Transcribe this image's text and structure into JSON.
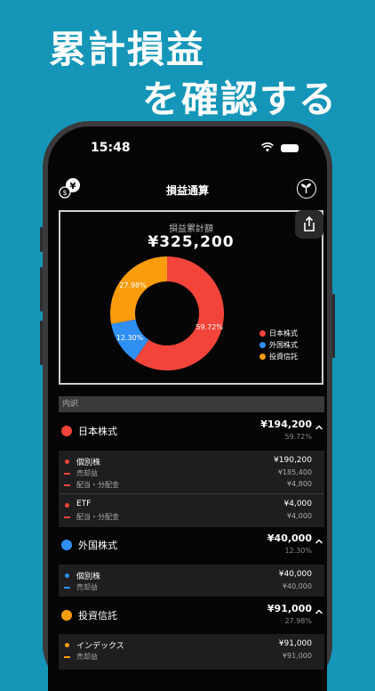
{
  "headline": {
    "line1": "累計損益",
    "line2": "を確認する"
  },
  "status": {
    "time": "15:48"
  },
  "nav": {
    "title": "損益通算"
  },
  "chart_title": "損益累計額",
  "total": "¥325,200",
  "colors": {
    "japan": "#f2443a",
    "foreign": "#2f8ff3",
    "fund": "#fb9c0c"
  },
  "chart_data": {
    "type": "pie",
    "categories": [
      "日本株式",
      "外国株式",
      "投資信託"
    ],
    "values": [
      59.72,
      12.3,
      27.98
    ],
    "labels": [
      "59.72%",
      "12.30%",
      "27.98%"
    ]
  },
  "legend": [
    "日本株式",
    "外国株式",
    "投資信託"
  ],
  "breakdown_header": "内訳",
  "categories": [
    {
      "name": "日本株式",
      "value": "¥194,200",
      "pct": "59.72%",
      "items": [
        {
          "name": "個別株",
          "value": "¥190,200",
          "details": [
            {
              "name": "売却益",
              "value": "¥185,400"
            },
            {
              "name": "配当・分配金",
              "value": "¥4,800"
            }
          ]
        },
        {
          "name": "ETF",
          "value": "¥4,000",
          "details": [
            {
              "name": "配当・分配金",
              "value": "¥4,000"
            }
          ]
        }
      ]
    },
    {
      "name": "外国株式",
      "value": "¥40,000",
      "pct": "12.30%",
      "items": [
        {
          "name": "個別株",
          "value": "¥40,000",
          "details": [
            {
              "name": "売却益",
              "value": "¥40,000"
            }
          ]
        }
      ]
    },
    {
      "name": "投資信託",
      "value": "¥91,000",
      "pct": "27.98%",
      "items": [
        {
          "name": "インデックス",
          "value": "¥91,000",
          "details": [
            {
              "name": "売却益",
              "value": "¥91,000"
            }
          ]
        }
      ]
    }
  ]
}
